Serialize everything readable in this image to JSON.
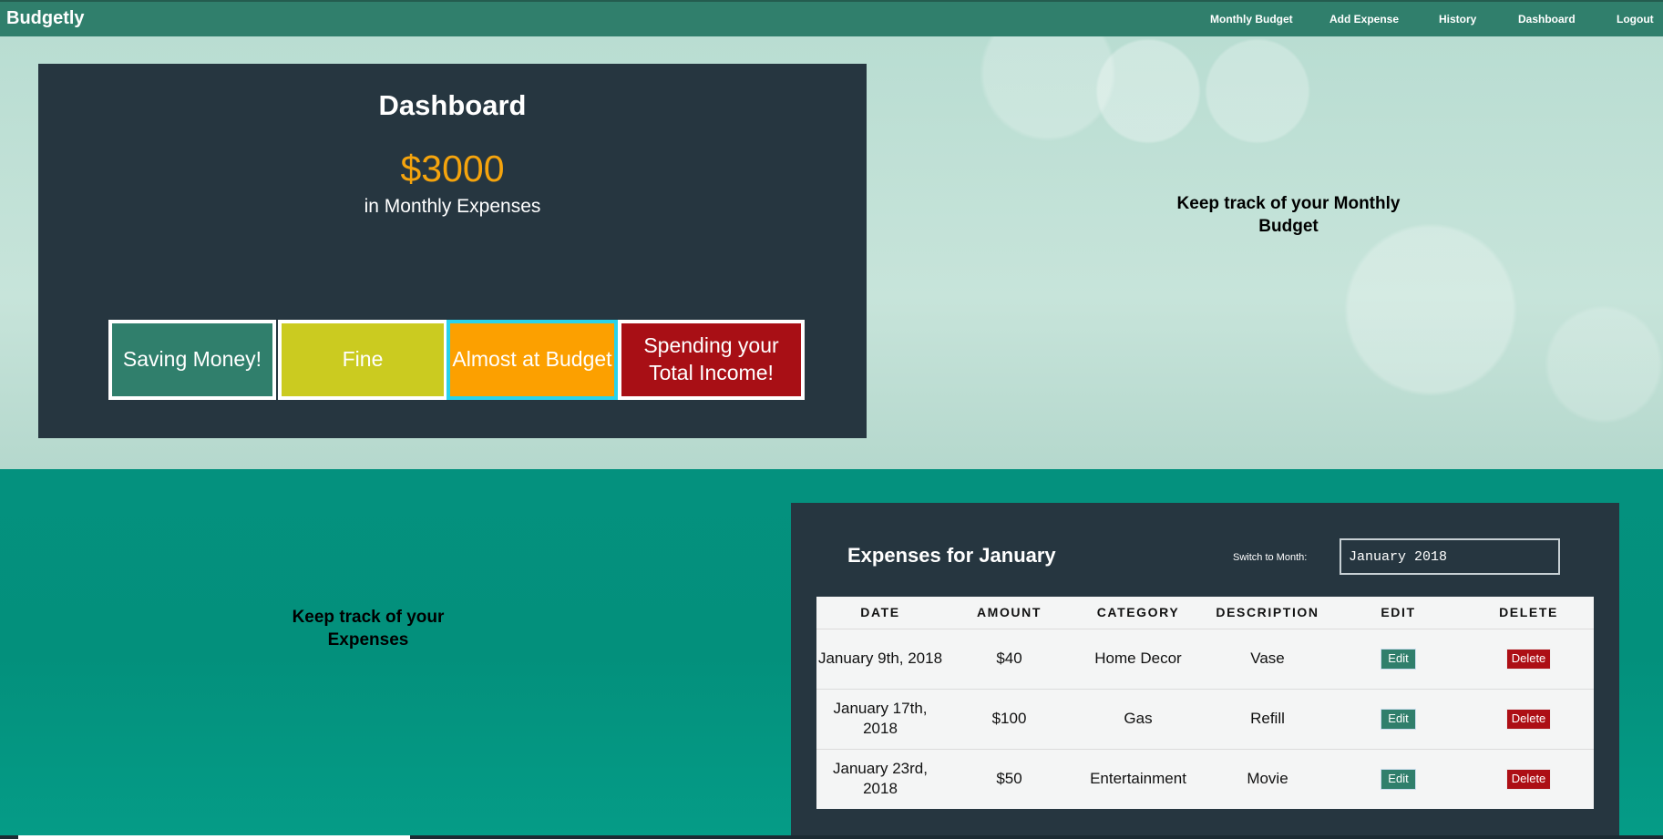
{
  "navbar": {
    "brand": "Budgetly",
    "links": [
      "Monthly Budget",
      "Add Expense",
      "History",
      "Dashboard",
      "Logout"
    ]
  },
  "dashboard": {
    "title": "Dashboard",
    "amount": "$3000",
    "caption": "in Monthly Expenses",
    "statuses": [
      {
        "label": "Saving Money!",
        "color": "#307f6c"
      },
      {
        "label": "Fine",
        "color": "#cbcb20"
      },
      {
        "label": "Almost at Budget",
        "color": "#fca000",
        "selected": true
      },
      {
        "label": "Spending your Total Income!",
        "color": "#a80f15"
      }
    ]
  },
  "taglines": {
    "budget": "Keep track of your Monthly Budget",
    "expenses": "Keep track of your Expenses"
  },
  "expenses": {
    "title": "Expenses for January",
    "switch_label": "Switch to Month:",
    "month_value": "January 2018",
    "columns": [
      "DATE",
      "AMOUNT",
      "CATEGORY",
      "DESCRIPTION",
      "EDIT",
      "DELETE"
    ],
    "rows": [
      {
        "date": "January 9th, 2018",
        "amount": "$40",
        "category": "Home Decor",
        "description": "Vase",
        "edit": "Edit",
        "delete": "Delete"
      },
      {
        "date": "January 17th, 2018",
        "amount": "$100",
        "category": "Gas",
        "description": "Refill",
        "edit": "Edit",
        "delete": "Delete"
      },
      {
        "date": "January 23rd, 2018",
        "amount": "$50",
        "category": "Entertainment",
        "description": "Movie",
        "edit": "Edit",
        "delete": "Delete"
      }
    ]
  }
}
